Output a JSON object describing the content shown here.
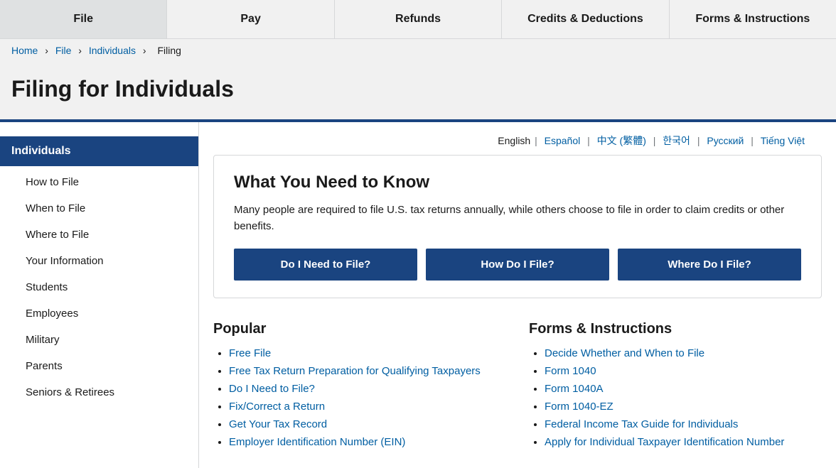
{
  "nav": {
    "items": [
      {
        "label": "File",
        "id": "file"
      },
      {
        "label": "Pay",
        "id": "pay"
      },
      {
        "label": "Refunds",
        "id": "refunds"
      },
      {
        "label": "Credits & Deductions",
        "id": "credits"
      },
      {
        "label": "Forms & Instructions",
        "id": "forms"
      }
    ]
  },
  "breadcrumb": {
    "items": [
      {
        "label": "Home",
        "href": "#"
      },
      {
        "label": "File",
        "href": "#"
      },
      {
        "label": "Individuals",
        "href": "#"
      },
      {
        "label": "Filing",
        "href": "#"
      }
    ]
  },
  "page_title": "Filing for Individuals",
  "language_bar": {
    "current": "English",
    "links": [
      {
        "label": "Español"
      },
      {
        "label": "中文 (繁體)"
      },
      {
        "label": "한국어"
      },
      {
        "label": "Русский"
      },
      {
        "label": "Tiếng Việt"
      }
    ]
  },
  "sidebar": {
    "active_label": "Individuals",
    "items": [
      {
        "label": "How to File"
      },
      {
        "label": "When to File"
      },
      {
        "label": "Where to File"
      },
      {
        "label": "Your Information"
      },
      {
        "label": "Students"
      },
      {
        "label": "Employees"
      },
      {
        "label": "Military"
      },
      {
        "label": "Parents"
      },
      {
        "label": "Seniors & Retirees"
      }
    ]
  },
  "info_box": {
    "title": "What You Need to Know",
    "description": "Many people are required to file U.S. tax returns annually, while others choose to file in order to claim credits or other benefits.",
    "buttons": [
      {
        "label": "Do I Need to File?"
      },
      {
        "label": "How Do I File?"
      },
      {
        "label": "Where Do I File?"
      }
    ]
  },
  "popular": {
    "heading": "Popular",
    "links": [
      {
        "label": "Free File"
      },
      {
        "label": "Free Tax Return Preparation for Qualifying Taxpayers"
      },
      {
        "label": "Do I Need to File?"
      },
      {
        "label": "Fix/Correct a Return"
      },
      {
        "label": "Get Your Tax Record"
      },
      {
        "label": "Employer Identification Number (EIN)"
      }
    ]
  },
  "forms_instructions": {
    "heading": "Forms & Instructions",
    "links": [
      {
        "label": "Decide Whether and When to File"
      },
      {
        "label": "Form 1040"
      },
      {
        "label": "Form 1040A"
      },
      {
        "label": "Form 1040-EZ"
      },
      {
        "label": "Federal Income Tax Guide for Individuals"
      },
      {
        "label": "Apply for Individual Taxpayer Identification Number"
      }
    ]
  }
}
